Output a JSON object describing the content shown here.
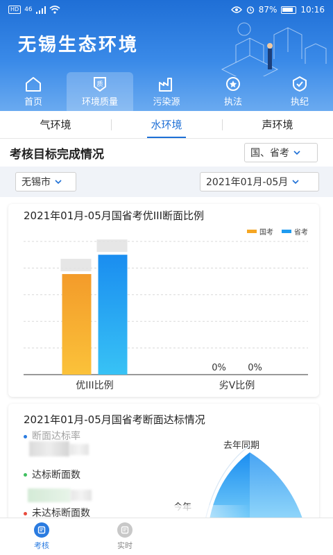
{
  "status_bar": {
    "network": "46",
    "battery": "87%",
    "time": "10:16"
  },
  "app": {
    "title": "无锡生态环境"
  },
  "nav": [
    {
      "label": "首页",
      "icon": "home-icon"
    },
    {
      "label": "环境质量",
      "icon": "quality-icon",
      "active": true
    },
    {
      "label": "污染源",
      "icon": "factory-icon"
    },
    {
      "label": "执法",
      "icon": "badge-icon"
    },
    {
      "label": "执纪",
      "icon": "shield-check-icon"
    }
  ],
  "tabs": [
    {
      "label": "气环境"
    },
    {
      "label": "水环境",
      "active": true
    },
    {
      "label": "声环境"
    }
  ],
  "section": {
    "title": "考核目标完成情况",
    "level_select": "国、省考"
  },
  "filters": {
    "city": "无锡市",
    "period": "2021年01月-05月"
  },
  "colors": {
    "accent": "#1d6fd6",
    "national": "#f5a623",
    "provincial": "#1e9bf0"
  },
  "chart_data": {
    "type": "bar",
    "title": "2021年01月-05月国省考优III断面比例",
    "categories": [
      "优III比例",
      "劣Ⅴ比例"
    ],
    "series": [
      {
        "name": "国考",
        "values": [
          null,
          0
        ]
      },
      {
        "name": "省考",
        "values": [
          null,
          0
        ]
      }
    ],
    "value_labels": [
      "",
      "",
      "0%",
      "0%"
    ],
    "legend_position": "top-right",
    "grid": true
  },
  "card2": {
    "title": "2021年01月-05月国省考断面达标情况",
    "items": [
      {
        "label": "断面达标率",
        "color": "#2a7be0"
      },
      {
        "label": "达标断面数",
        "color": "#3fbf5f"
      },
      {
        "label": "未达标断面数",
        "color": "#e94b3c"
      }
    ],
    "compare_label": "去年同期",
    "current_label": "今年"
  },
  "bottom_nav": [
    {
      "label": "考核",
      "icon": "assessment-icon",
      "active": true
    },
    {
      "label": "实时",
      "icon": "realtime-icon"
    }
  ]
}
